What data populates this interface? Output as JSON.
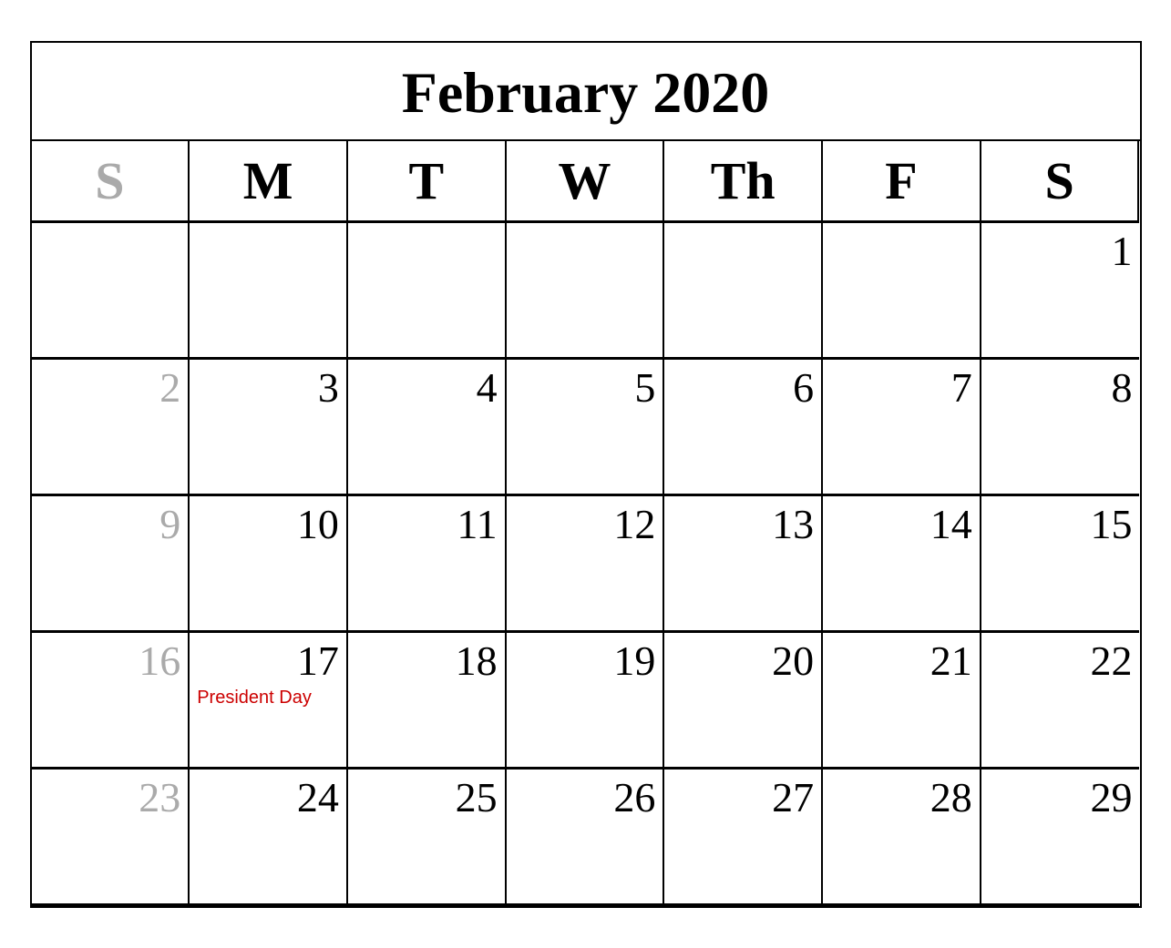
{
  "calendar": {
    "title": "February 2020",
    "headers": [
      {
        "label": "S",
        "gray": true
      },
      {
        "label": "M",
        "gray": false
      },
      {
        "label": "T",
        "gray": false
      },
      {
        "label": "W",
        "gray": false
      },
      {
        "label": "Th",
        "gray": false
      },
      {
        "label": "F",
        "gray": false
      },
      {
        "label": "S",
        "gray": false
      }
    ],
    "rows": [
      [
        {
          "day": "",
          "gray": true
        },
        {
          "day": "",
          "gray": false
        },
        {
          "day": "",
          "gray": false
        },
        {
          "day": "",
          "gray": false
        },
        {
          "day": "",
          "gray": false
        },
        {
          "day": "",
          "gray": false
        },
        {
          "day": "1",
          "gray": false
        }
      ],
      [
        {
          "day": "2",
          "gray": true
        },
        {
          "day": "3",
          "gray": false
        },
        {
          "day": "4",
          "gray": false
        },
        {
          "day": "5",
          "gray": false
        },
        {
          "day": "6",
          "gray": false
        },
        {
          "day": "7",
          "gray": false
        },
        {
          "day": "8",
          "gray": false
        }
      ],
      [
        {
          "day": "9",
          "gray": true
        },
        {
          "day": "10",
          "gray": false
        },
        {
          "day": "11",
          "gray": false
        },
        {
          "day": "12",
          "gray": false
        },
        {
          "day": "13",
          "gray": false
        },
        {
          "day": "14",
          "gray": false
        },
        {
          "day": "15",
          "gray": false
        }
      ],
      [
        {
          "day": "16",
          "gray": true
        },
        {
          "day": "17",
          "gray": false,
          "event": "President Day"
        },
        {
          "day": "18",
          "gray": false
        },
        {
          "day": "19",
          "gray": false
        },
        {
          "day": "20",
          "gray": false
        },
        {
          "day": "21",
          "gray": false
        },
        {
          "day": "22",
          "gray": false
        }
      ],
      [
        {
          "day": "23",
          "gray": true
        },
        {
          "day": "24",
          "gray": false
        },
        {
          "day": "25",
          "gray": false
        },
        {
          "day": "26",
          "gray": false
        },
        {
          "day": "27",
          "gray": false
        },
        {
          "day": "28",
          "gray": false
        },
        {
          "day": "29",
          "gray": false
        }
      ]
    ]
  }
}
